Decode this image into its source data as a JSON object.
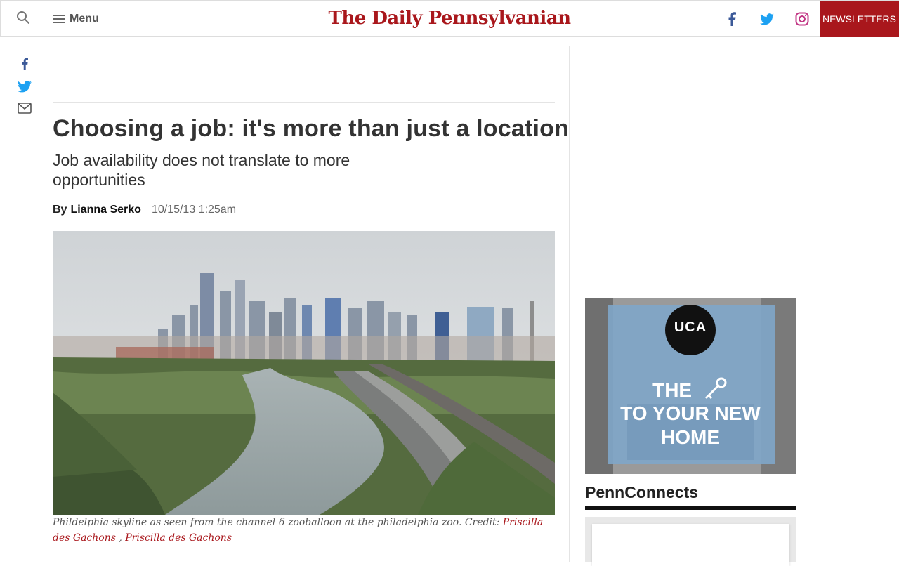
{
  "header": {
    "brand": "The Daily Pennsylvanian",
    "menu_label": "Menu",
    "newsletters_label": "NEWSLETTERS",
    "icons": [
      "search-icon",
      "menu-icon",
      "facebook-icon",
      "twitter-icon",
      "instagram-icon"
    ]
  },
  "share": {
    "icons": [
      "facebook-icon",
      "twitter-icon",
      "email-icon"
    ]
  },
  "article": {
    "headline": "Choosing a job: it's more than just a location",
    "subheadline": "Job availability does not translate to more opportunities",
    "byline_prefix": "By",
    "author": "Lianna Serko",
    "date": "10/15/13 1:25am",
    "caption_text": "Phildelphia skyline as seen from the channel 6 zooballoon at the philadelphia zoo. Credit: ",
    "credit_1": "Priscilla des Gachons",
    "credit_sep": " , ",
    "credit_2": "Priscilla des Gachons"
  },
  "ad": {
    "logo": "UCA",
    "line1": "THE",
    "line2": "TO YOUR NEW",
    "line3": "HOME"
  },
  "sidebar": {
    "section_title": "PennConnects"
  },
  "colors": {
    "brand_red": "#a9171c",
    "facebook": "#3b5998",
    "twitter": "#1da1f2",
    "instagram": "#c13584"
  }
}
